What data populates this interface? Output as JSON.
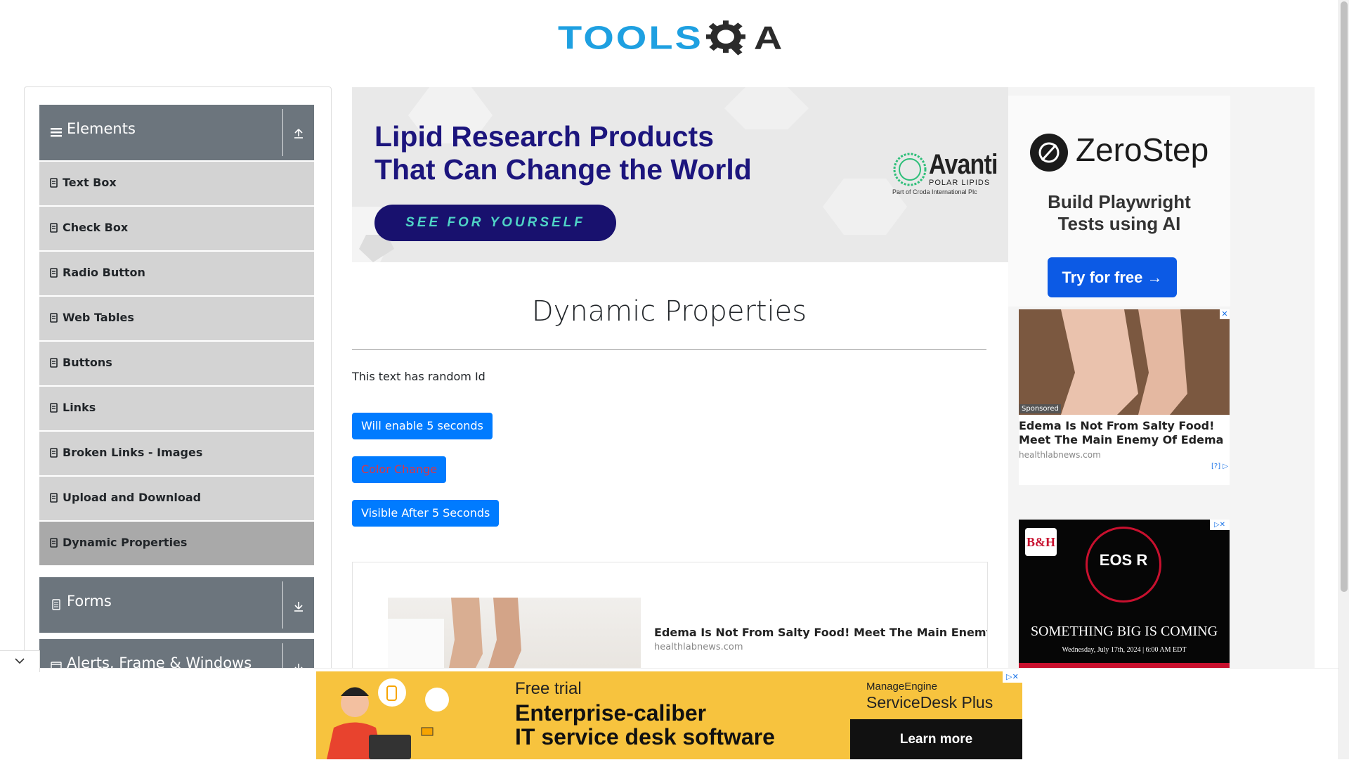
{
  "header": {
    "logo_text_left": "TOOLS",
    "logo_text_right": "A"
  },
  "sidebar": {
    "elements_group": {
      "title": "Elements"
    },
    "items": [
      {
        "label": "Text Box"
      },
      {
        "label": "Check Box"
      },
      {
        "label": "Radio Button"
      },
      {
        "label": "Web Tables"
      },
      {
        "label": "Buttons"
      },
      {
        "label": "Links"
      },
      {
        "label": "Broken Links - Images"
      },
      {
        "label": "Upload and Download"
      },
      {
        "label": "Dynamic Properties"
      }
    ],
    "forms_group": {
      "title": "Forms"
    },
    "alerts_group": {
      "title": "Alerts, Frame & Windows"
    }
  },
  "top_ad": {
    "headline_line1": "Lipid Research Products",
    "headline_line2": "That Can Change the World",
    "cta": "SEE FOR YOURSELF",
    "brand": "Avanti",
    "brand_sub": "POLAR LIPIDS",
    "brand_part": "Part of Croda International Plc"
  },
  "main": {
    "title": "Dynamic Properties",
    "random_text": "This text has random Id",
    "enable_button": "Will enable 5 seconds",
    "color_button": "Color Change",
    "visible_button": "Visible After 5 Seconds"
  },
  "inline_ad": {
    "headline": "Edema Is Not From Salty Food! Meet The Main Enemy Of Edema",
    "domain": "healthlabnews.com"
  },
  "right_ads": {
    "zerostep": {
      "name": "ZeroStep",
      "tagline_line1": "Build Playwright",
      "tagline_line2": "Tests using AI",
      "cta": "Try for free →"
    },
    "edema": {
      "sponsored": "Sponsored",
      "headline": "Edema Is Not From Salty Food! Meet The Main Enemy Of Edema",
      "domain": "healthlabnews.com",
      "adchoices": "[?]"
    },
    "bh": {
      "logo": "B&H",
      "product": "EOS R",
      "headline": "SOMETHING BIG IS COMING",
      "date": "Wednesday, July 17th, 2024 | 6:00 AM EDT"
    }
  },
  "bottom_ad": {
    "free_trial": "Free trial",
    "line1": "Enterprise-caliber",
    "line2": "IT service desk software",
    "brand_top": "ManageEngine",
    "brand_product": "ServiceDesk Plus",
    "cta": "Learn more"
  },
  "colors": {
    "primary": "#007bff",
    "sidebar_header": "#6c757d",
    "sidebar_item": "#d3d3d3",
    "sidebar_active": "#a9a9a9",
    "color_change_text": "#dc3545"
  }
}
